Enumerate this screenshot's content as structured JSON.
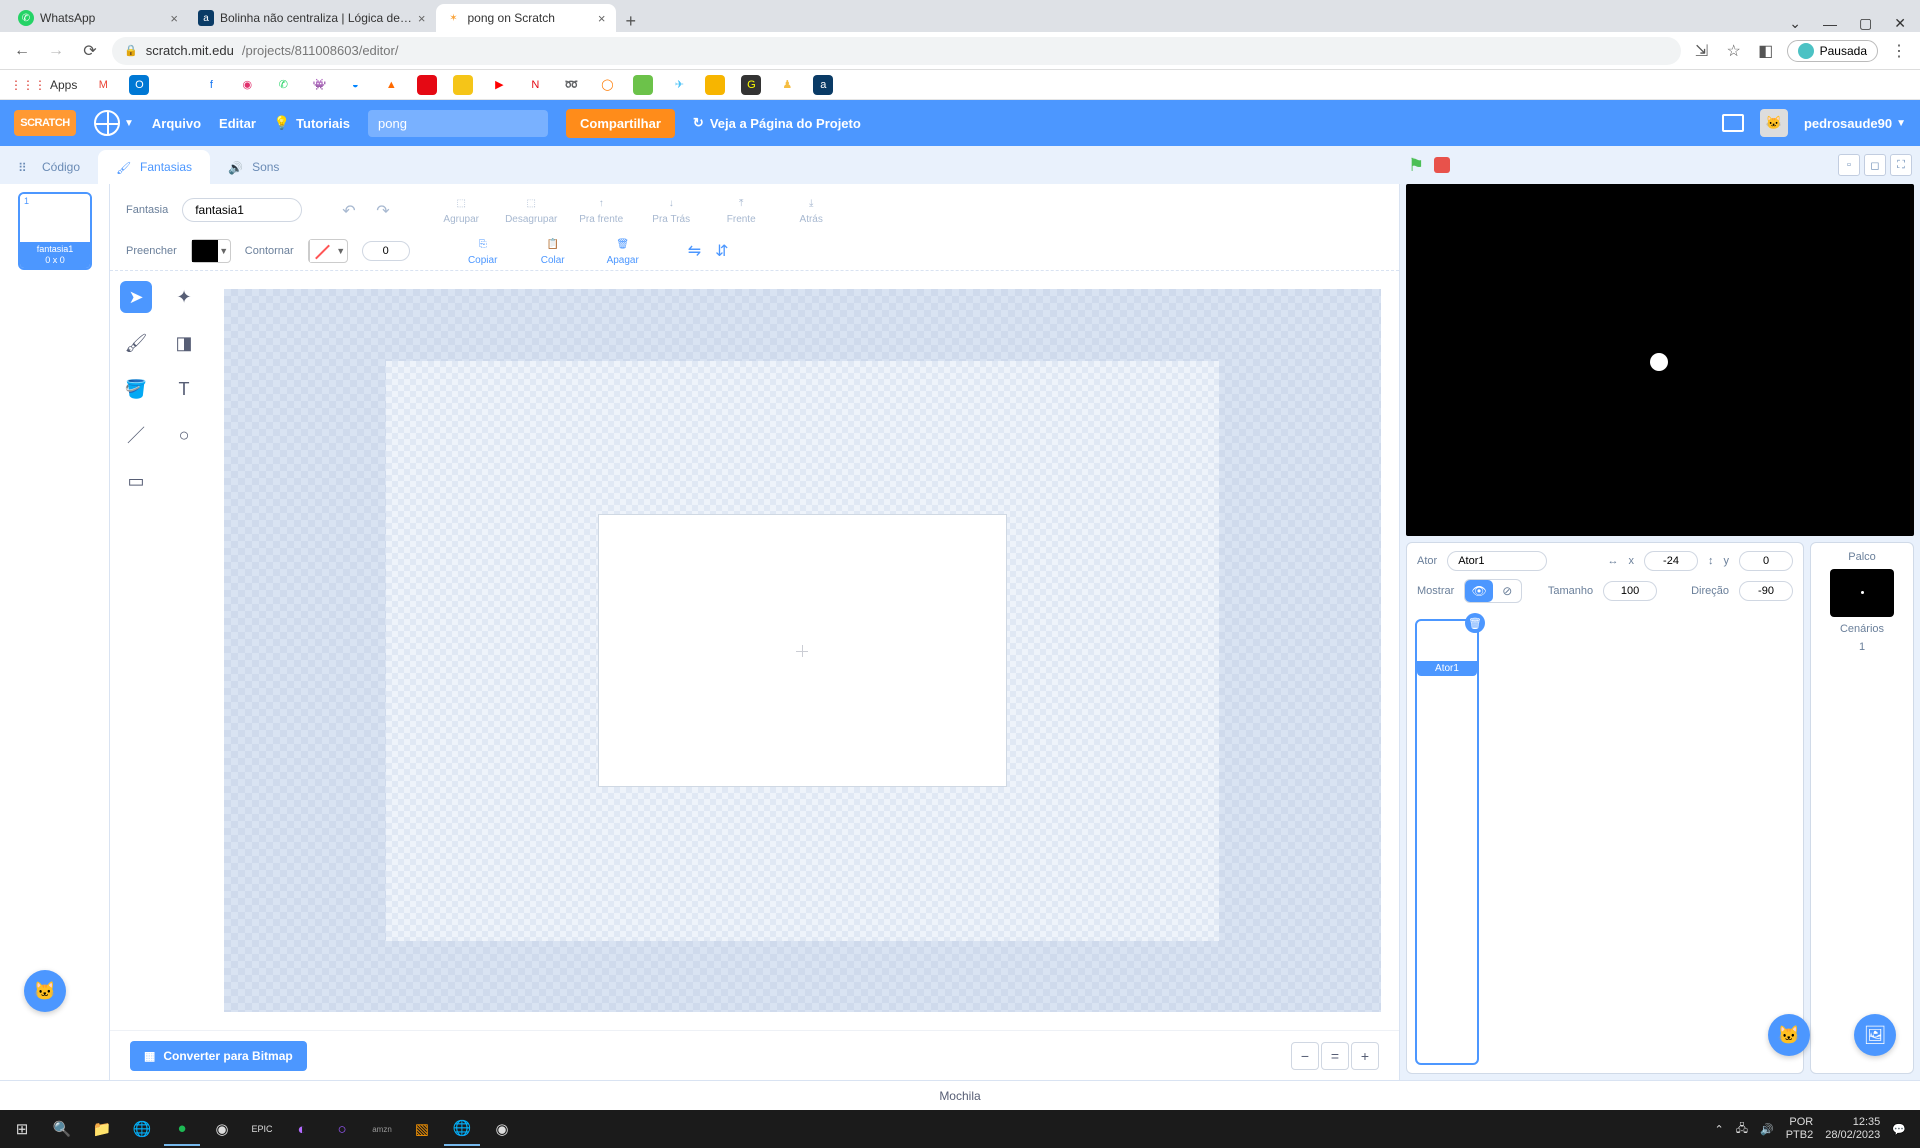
{
  "browser": {
    "tabs": [
      {
        "title": "WhatsApp",
        "fav_bg": "#25d366"
      },
      {
        "title": "Bolinha não centraliza | Lógica de…",
        "fav_bg": "#0a3b66"
      },
      {
        "title": "pong on Scratch",
        "fav_bg": "#f9a33a"
      }
    ],
    "url_host": "scratch.mit.edu",
    "url_path": "/projects/811008603/editor/",
    "paused_label": "Pausada",
    "apps_label": "Apps"
  },
  "scratch_bar": {
    "menu_file": "Arquivo",
    "menu_edit": "Editar",
    "tutorials": "Tutoriais",
    "project_title": "pong",
    "share": "Compartilhar",
    "see_page": "Veja a Página do Projeto",
    "username": "pedrosaude90"
  },
  "tabs": {
    "code": "Código",
    "costumes": "Fantasias",
    "sounds": "Sons"
  },
  "costume": {
    "thumb_name": "fantasia1",
    "thumb_size": "0 x 0",
    "thumb_num": "1",
    "name_label": "Fantasia",
    "name_value": "fantasia1",
    "fill_label": "Preencher",
    "outline_label": "Contornar",
    "outline_width": "0",
    "btn_group": "Agrupar",
    "btn_ungroup": "Desagrupar",
    "btn_forward": "Pra frente",
    "btn_backward": "Pra Trás",
    "btn_front": "Frente",
    "btn_back": "Atrás",
    "btn_copy": "Copiar",
    "btn_paste": "Colar",
    "btn_delete": "Apagar",
    "convert_bitmap": "Converter para Bitmap"
  },
  "sprite": {
    "label_ator": "Ator",
    "name": "Ator1",
    "x_label": "x",
    "x": "-24",
    "y_label": "y",
    "y": "0",
    "show_label": "Mostrar",
    "size_label": "Tamanho",
    "size": "100",
    "dir_label": "Direção",
    "dir": "-90",
    "item_name": "Ator1"
  },
  "stage": {
    "label": "Palco",
    "backdrops_label": "Cenários",
    "backdrops_count": "1"
  },
  "backpack": "Mochila",
  "taskbar": {
    "lang1": "POR",
    "lang2": "PTB2",
    "time": "12:35",
    "date": "28/02/2023"
  }
}
